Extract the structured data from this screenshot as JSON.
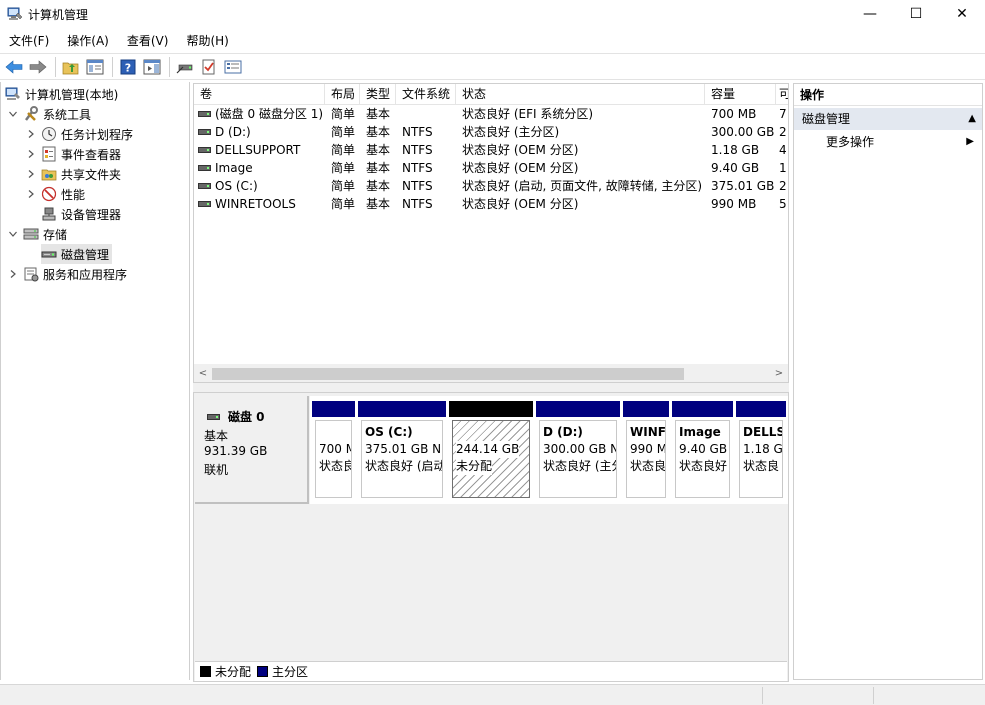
{
  "window": {
    "title": "计算机管理",
    "minimize_glyph": "—",
    "maximize_glyph": "☐",
    "close_glyph": "✕"
  },
  "menu": [
    "文件(F)",
    "操作(A)",
    "查看(V)",
    "帮助(H)"
  ],
  "toolbar": {
    "icons": [
      "back-arrow-icon",
      "forward-arrow-icon",
      "up-folder-icon",
      "show-hide-tree-icon",
      "help-icon",
      "show-hide-action-pane-icon",
      "connect-disk-icon",
      "checkmark-icon",
      "properties-icon"
    ]
  },
  "tree": {
    "root": "计算机管理(本地)",
    "system_tools": "系统工具",
    "task_scheduler": "任务计划程序",
    "event_viewer": "事件查看器",
    "shared_folders": "共享文件夹",
    "performance": "性能",
    "device_manager": "设备管理器",
    "storage": "存储",
    "disk_management": "磁盘管理",
    "services_apps": "服务和应用程序"
  },
  "volumes": {
    "columns": [
      "卷",
      "布局",
      "类型",
      "文件系统",
      "状态",
      "容量",
      "可"
    ],
    "rows": [
      {
        "name": "(磁盘 0 磁盘分区 1)",
        "layout": "简单",
        "type": "基本",
        "fs": "",
        "status": "状态良好 (EFI 系统分区)",
        "capacity": "700 MB",
        "free": "7"
      },
      {
        "name": "D (D:)",
        "layout": "简单",
        "type": "基本",
        "fs": "NTFS",
        "status": "状态良好 (主分区)",
        "capacity": "300.00 GB",
        "free": "2"
      },
      {
        "name": "DELLSUPPORT",
        "layout": "简单",
        "type": "基本",
        "fs": "NTFS",
        "status": "状态良好 (OEM 分区)",
        "capacity": "1.18 GB",
        "free": "4"
      },
      {
        "name": "Image",
        "layout": "简单",
        "type": "基本",
        "fs": "NTFS",
        "status": "状态良好 (OEM 分区)",
        "capacity": "9.40 GB",
        "free": "1"
      },
      {
        "name": "OS (C:)",
        "layout": "简单",
        "type": "基本",
        "fs": "NTFS",
        "status": "状态良好 (启动, 页面文件, 故障转储, 主分区)",
        "capacity": "375.01 GB",
        "free": "2"
      },
      {
        "name": "WINRETOOLS",
        "layout": "简单",
        "type": "基本",
        "fs": "NTFS",
        "status": "状态良好 (OEM 分区)",
        "capacity": "990 MB",
        "free": "5"
      }
    ],
    "scroll_left": "<",
    "scroll_right": ">"
  },
  "disk": {
    "name": "磁盘 0",
    "type": "基本",
    "size": "931.39 GB",
    "state": "联机",
    "partitions": [
      {
        "label": "",
        "size": "700 M",
        "status": "状态良",
        "kind": "primary"
      },
      {
        "label": "OS  (C:)",
        "size": "375.01 GB N",
        "status": "状态良好 (启动",
        "kind": "primary"
      },
      {
        "label": "",
        "size": "244.14 GB",
        "status": "未分配",
        "kind": "unallocated"
      },
      {
        "label": "D  (D:)",
        "size": "300.00 GB N",
        "status": "状态良好 (主分",
        "kind": "primary"
      },
      {
        "label": "WINF",
        "size": "990 M",
        "status": "状态良",
        "kind": "primary"
      },
      {
        "label": "Image",
        "size": "9.40 GB",
        "status": "状态良好",
        "kind": "primary"
      },
      {
        "label": "DELLS",
        "size": "1.18 G",
        "status": "状态良",
        "kind": "primary"
      }
    ]
  },
  "legend": {
    "unallocated": "未分配",
    "primary": "主分区",
    "unallocated_color": "#000000",
    "primary_color": "#00007f"
  },
  "actions": {
    "header": "操作",
    "section": "磁盘管理",
    "more": "更多操作",
    "collapse_glyph": "▲",
    "more_glyph": "▶"
  }
}
